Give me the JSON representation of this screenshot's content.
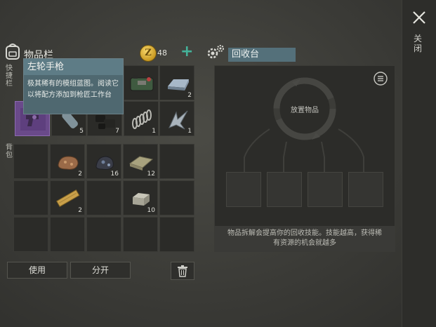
{
  "close": {
    "label": "关闭"
  },
  "inventory": {
    "title": "物品栏",
    "quick_tab_label": "快捷栏",
    "backpack_tab_label": "背包",
    "coins": "48",
    "quick_slots": [
      {
        "item": "revolver-blueprint",
        "qty": ""
      },
      {
        "item": "plastic-bottle",
        "qty": "5"
      },
      {
        "item": "tire-scrap",
        "qty": "7"
      },
      {
        "item": "spring",
        "qty": "1"
      },
      {
        "item": "metal-shard",
        "qty": "1"
      },
      {
        "item": "",
        "qty": ""
      },
      {
        "item": "",
        "qty": ""
      },
      {
        "item": "battery-pack",
        "qty": ""
      },
      {
        "item": "steel-ingot",
        "qty": "2"
      }
    ],
    "backpack_slots": [
      {
        "item": "",
        "qty": ""
      },
      {
        "item": "copper-ore",
        "qty": "2"
      },
      {
        "item": "coal-ore",
        "qty": "16"
      },
      {
        "item": "cloth",
        "qty": "12"
      },
      {
        "item": "",
        "qty": ""
      },
      {
        "item": "",
        "qty": ""
      },
      {
        "item": "wood-plank",
        "qty": "2"
      },
      {
        "item": "",
        "qty": ""
      },
      {
        "item": "stone-block",
        "qty": "10"
      },
      {
        "item": "",
        "qty": ""
      }
    ]
  },
  "tooltip": {
    "title": "左轮手枪",
    "description": "极其稀有的模组蓝图。阅读它以将配方添加到枪匠工作台"
  },
  "actions": {
    "use_label": "使用",
    "split_label": "分开"
  },
  "recycler": {
    "title": "回收台",
    "place_label": "放置物品",
    "note_line1": "物品拆解会提高你的回收技能。技能越高，获得稀",
    "note_line2": "有资源的机会就越多"
  },
  "colors": {
    "accent_teal": "#44b39a",
    "title_bar": "#54707a",
    "tooltip_bg": "#4f6870"
  }
}
